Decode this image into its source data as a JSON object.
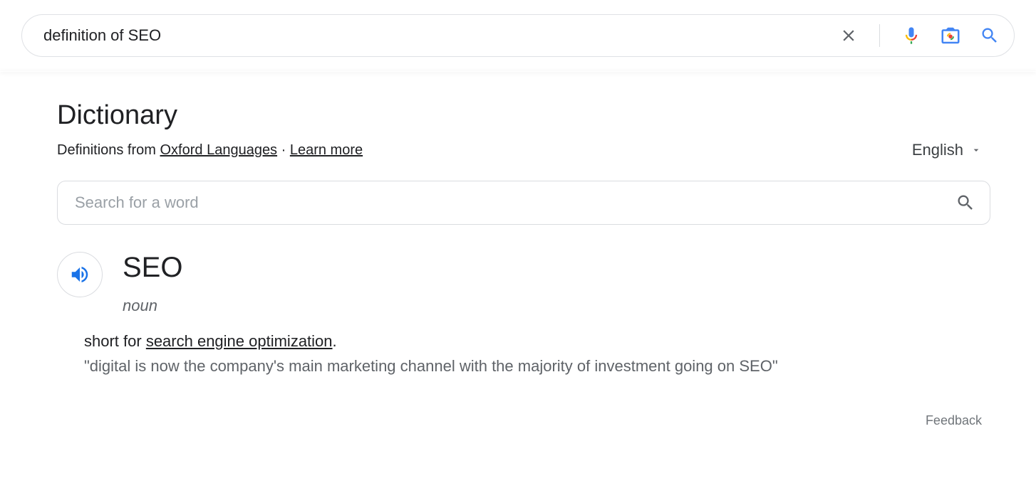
{
  "search": {
    "query": "definition of SEO"
  },
  "dictionary": {
    "title": "Dictionary",
    "source_prefix": "Definitions from ",
    "source_link": "Oxford Languages",
    "separator": " · ",
    "learn_more": "Learn more",
    "language": "English",
    "word_search_placeholder": "Search for a word",
    "headword": "SEO",
    "part_of_speech": "noun",
    "definition_prefix": "short for ",
    "definition_link": "search engine optimization",
    "definition_suffix": ".",
    "example": "\"digital is now the company's main marketing channel with the majority of investment going on SEO\"",
    "feedback": "Feedback"
  }
}
